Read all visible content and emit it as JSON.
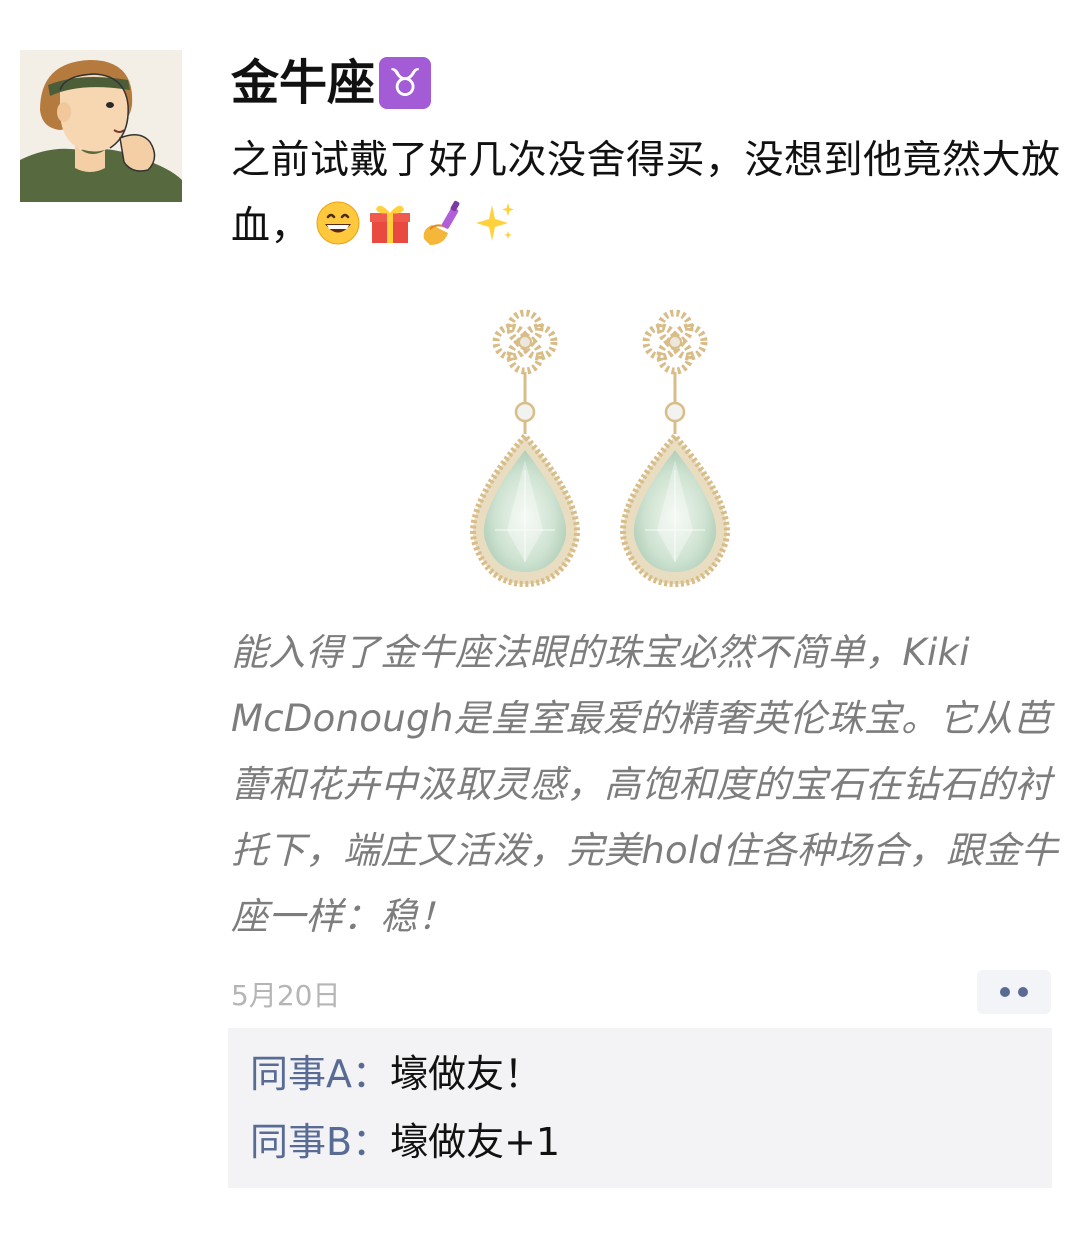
{
  "post": {
    "username": "金牛座",
    "zodiac_symbol": "♉",
    "text": "之前试戴了好几次没舍得买，没想到他竟然大放血，",
    "emoji_icons": [
      "grinning-face-icon",
      "wrapped-gift-icon",
      "nail-polish-icon",
      "sparkles-icon"
    ],
    "caption": "能入得了金牛座法眼的珠宝必然不简单，Kiki McDonough是皇室最爱的精奢英伦珠宝。它从芭蕾和花卉中汲取灵感，高饱和度的宝石在钻石的衬托下，端庄又活泼，完美hold住各种场合，跟金牛座一样：稳！",
    "timestamp": "5月20日"
  },
  "comments": [
    {
      "author": "同事A",
      "separator": "：",
      "text": "壕做友！"
    },
    {
      "author": "同事B",
      "separator": "：",
      "text": "壕做友+1"
    }
  ],
  "colors": {
    "author_link": "#576b95",
    "caption_gray": "#7d7d7d",
    "timestamp_gray": "#b5b5b5",
    "comment_bg": "#f3f3f5",
    "zodiac_purple": "#a35bd6"
  }
}
